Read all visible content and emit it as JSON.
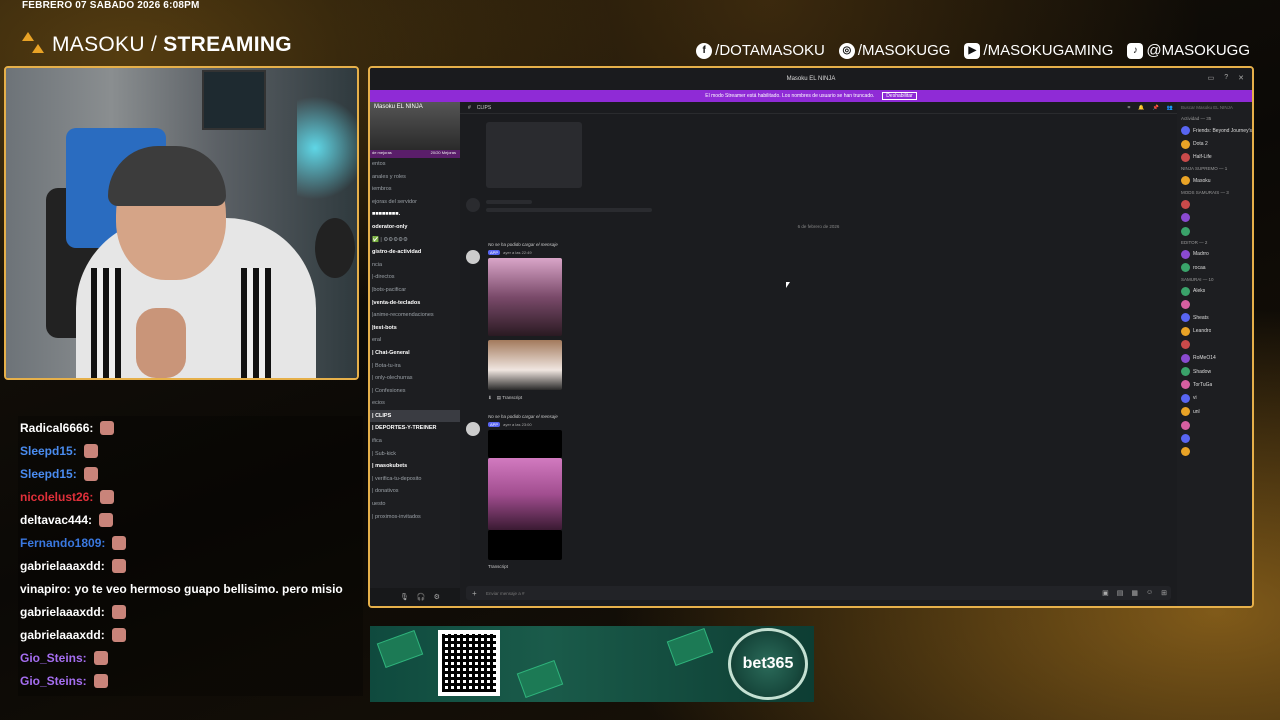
{
  "overlay": {
    "date": "FEBRERO 07 SABADO 2026 6:08PM",
    "brand_light": "MASOKU /",
    "brand_bold": "STREAMING",
    "socials": [
      {
        "icon": "facebook-icon",
        "glyph": "f",
        "label": "/DOTAMASOKU"
      },
      {
        "icon": "instagram-icon",
        "glyph": "◎",
        "label": "/MASOKUGG"
      },
      {
        "icon": "youtube-icon",
        "glyph": "▶",
        "label": "/MASOKUGAMING"
      },
      {
        "icon": "tiktok-icon",
        "glyph": "♪",
        "label": "@MASOKUGG"
      }
    ]
  },
  "chat": {
    "messages": [
      {
        "user": "Radical6666:",
        "color": "#ffffff",
        "text": ""
      },
      {
        "user": "Sleepd15:",
        "color": "#4a8cf0",
        "text": ""
      },
      {
        "user": "Sleepd15:",
        "color": "#4a8cf0",
        "text": ""
      },
      {
        "user": "nicolelust26:",
        "color": "#e0303a",
        "text": ""
      },
      {
        "user": "deltavac444:",
        "color": "#ffffff",
        "text": ""
      },
      {
        "user": "Fernando1809:",
        "color": "#3a78e0",
        "text": ""
      },
      {
        "user": "gabrielaaaxdd:",
        "color": "#ffffff",
        "text": ""
      },
      {
        "user": "vinapiro:",
        "color": "#ffffff",
        "text": "yo te veo hermoso guapo bellisimo. pero misio"
      },
      {
        "user": "gabrielaaaxdd:",
        "color": "#ffffff",
        "text": ""
      },
      {
        "user": "gabrielaaaxdd:",
        "color": "#ffffff",
        "text": ""
      },
      {
        "user": "Gio_Steins:",
        "color": "#a56ef0",
        "text": ""
      },
      {
        "user": "Gio_Steins:",
        "color": "#a56ef0",
        "text": ""
      }
    ]
  },
  "discord": {
    "window_title": "Masoku EL NINJA",
    "streamer_notice": "El modo Streamer está habilitado. Los nombres de usuario se han truncado.",
    "streamer_button": "Deshabilitar",
    "server_name": "Masoku EL NINJA",
    "boost_label": "de mejoras",
    "boost_count": "20/20 Mejoras",
    "channels": [
      {
        "label": "entos",
        "style": ""
      },
      {
        "label": "anales y roles",
        "style": ""
      },
      {
        "label": "iembros",
        "style": ""
      },
      {
        "label": "ejoras del servidor",
        "style": ""
      },
      {
        "label": "■■■■■■■■.",
        "style": "bright"
      },
      {
        "label": "oderator-only",
        "style": "bright"
      },
      {
        "label": "✅ | ⚙⚙⚙⚙⚙",
        "style": ""
      },
      {
        "label": "gistro-de-actividad",
        "style": "bright"
      },
      {
        "label": "ncia",
        "style": ""
      },
      {
        "label": "|-directos",
        "style": ""
      },
      {
        "label": "|bots-pacificar",
        "style": ""
      },
      {
        "label": "|venta-de-teclados",
        "style": "bright"
      },
      {
        "label": "|anime-recomendaciones",
        "style": ""
      },
      {
        "label": "|test-bots",
        "style": "bright"
      },
      {
        "label": "eral",
        "style": ""
      },
      {
        "label": "| Chat-General",
        "style": "bright"
      },
      {
        "label": "| Bota-tu-ira",
        "style": ""
      },
      {
        "label": "| only-olechurras",
        "style": ""
      },
      {
        "label": "| Confesiones",
        "style": ""
      },
      {
        "label": "ecios",
        "style": ""
      },
      {
        "label": "| CLIPS",
        "style": "active"
      },
      {
        "label": "| DEPORTES-Y-TREINER",
        "style": "bright"
      },
      {
        "label": "ifica",
        "style": ""
      },
      {
        "label": "| Sub-kick",
        "style": ""
      },
      {
        "label": "| masokubets",
        "style": "bright"
      },
      {
        "label": "| verifica-tu-deposito",
        "style": ""
      },
      {
        "label": "| donativos",
        "style": ""
      },
      {
        "label": "uesto",
        "style": ""
      },
      {
        "label": "| proximos-invitados",
        "style": ""
      }
    ],
    "channel_header": "CLIPS",
    "date_divider": "6 de febrero de 2026",
    "messages": [
      {
        "reply": "No se ha podido cargar el mensaje",
        "badge": "APP",
        "time": "ayer a las 22:49",
        "transcript": "Transcript"
      },
      {
        "reply": "No se ha podido cargar el mensaje",
        "badge": "APP",
        "time": "ayer a las 23:00",
        "transcript": "Transcript"
      }
    ],
    "input_placeholder": "Enviar mensaje a #",
    "member_search": "Buscar Masoku EL NINJA",
    "member_groups": [
      {
        "title": "Actividad — 35",
        "members": [
          "Friends: Beyond Journey's",
          "Dota 2",
          "Half-Life"
        ]
      },
      {
        "title": "NINJA SUPREMO — 1",
        "members": [
          "Masoku"
        ]
      },
      {
        "title": "MODS SAMURAIS — 3",
        "members": [
          "",
          "",
          ""
        ]
      },
      {
        "title": "EDITOR — 2",
        "members": [
          "Madrro",
          "rocaa"
        ]
      },
      {
        "title": "SAMURAI — 10",
        "members": [
          "Aleks",
          "",
          "Sheats",
          "Leandro",
          "",
          "RoMeO14",
          "Shadow",
          "TorTuGa",
          "vi",
          "unl"
        ]
      },
      {
        "title": "",
        "members": [
          "",
          "",
          ""
        ]
      }
    ]
  },
  "ad": {
    "brand": "bet365"
  }
}
